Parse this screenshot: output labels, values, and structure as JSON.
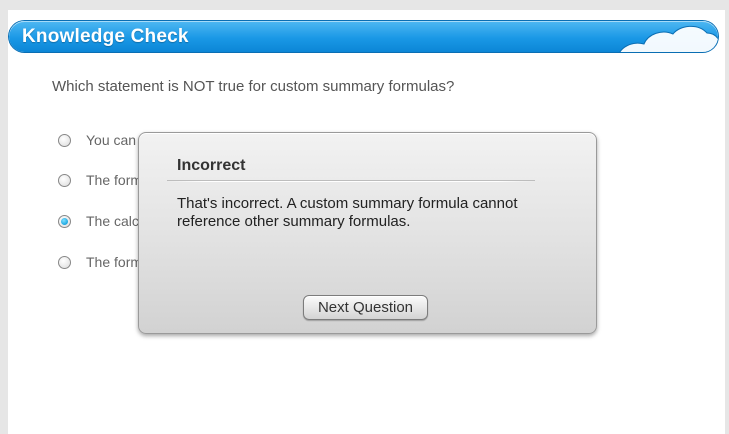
{
  "header": {
    "title": "Knowledge Check"
  },
  "question": {
    "text": "Which statement is NOT true for custom summary formulas?"
  },
  "options": [
    {
      "label": "You can",
      "selected": false
    },
    {
      "label": "The form",
      "selected": false
    },
    {
      "label": "The calc",
      "selected": true
    },
    {
      "label": "The form",
      "selected": false
    }
  ],
  "feedback": {
    "title": "Incorrect",
    "message": "That's incorrect. A custom summary formula cannot reference other summary formulas.",
    "button_label": "Next Question"
  },
  "colors": {
    "accent": "#1a98e6",
    "selected_radio": "#1aa6e0"
  }
}
